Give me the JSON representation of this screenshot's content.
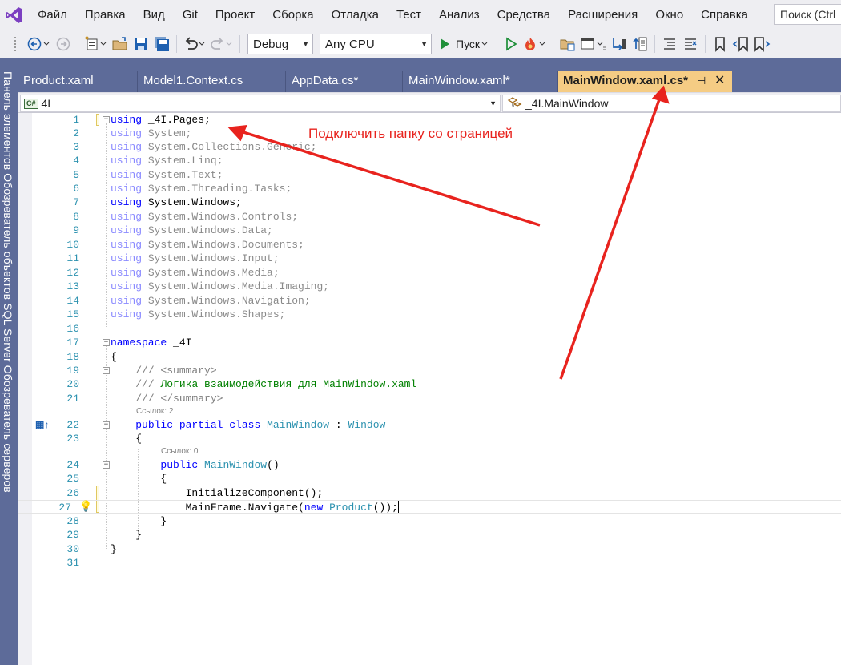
{
  "menu": [
    "Файл",
    "Правка",
    "Вид",
    "Git",
    "Проект",
    "Сборка",
    "Отладка",
    "Тест",
    "Анализ",
    "Средства",
    "Расширения",
    "Окно",
    "Справка"
  ],
  "search": {
    "placeholder": "Поиск (Ctrl"
  },
  "toolbar": {
    "configuration": "Debug",
    "platform": "Any CPU",
    "run_label": "Пуск"
  },
  "side_panel_text": "Панель элементов   Обозреватель объектов SQL Server   Обозреватель серверов",
  "tabs": [
    {
      "label": "Product.xaml"
    },
    {
      "label": "Model1.Context.cs"
    },
    {
      "label": "AppData.cs*"
    },
    {
      "label": "MainWindow.xaml*"
    },
    {
      "label": "MainWindow.xaml.cs*",
      "active": true
    }
  ],
  "navbar": {
    "project_badge": "C#",
    "project": "4I",
    "class": "_4I.MainWindow"
  },
  "annotation": {
    "text": "Подключить папку со страницей",
    "color": "#e8231e"
  },
  "code": {
    "l1": {
      "n": "1",
      "kw": "using",
      "rest": " _4I.Pages;"
    },
    "l2": {
      "n": "2",
      "kw": "using",
      "rest": " System;"
    },
    "l3": {
      "n": "3",
      "kw": "using",
      "rest": " System.Collections.Generic;"
    },
    "l4": {
      "n": "4",
      "kw": "using",
      "rest": " System.Linq;"
    },
    "l5": {
      "n": "5",
      "kw": "using",
      "rest": " System.Text;"
    },
    "l6": {
      "n": "6",
      "kw": "using",
      "rest": " System.Threading.Tasks;"
    },
    "l7": {
      "n": "7",
      "kw": "using",
      "rest": " System.Windows;"
    },
    "l8": {
      "n": "8",
      "kw": "using",
      "rest": " System.Windows.Controls;"
    },
    "l9": {
      "n": "9",
      "kw": "using",
      "rest": " System.Windows.Data;"
    },
    "l10": {
      "n": "10",
      "kw": "using",
      "rest": " System.Windows.Documents;"
    },
    "l11": {
      "n": "11",
      "kw": "using",
      "rest": " System.Windows.Input;"
    },
    "l12": {
      "n": "12",
      "kw": "using",
      "rest": " System.Windows.Media;"
    },
    "l13": {
      "n": "13",
      "kw": "using",
      "rest": " System.Windows.Media.Imaging;"
    },
    "l14": {
      "n": "14",
      "kw": "using",
      "rest": " System.Windows.Navigation;"
    },
    "l15": {
      "n": "15",
      "kw": "using",
      "rest": " System.Windows.Shapes;"
    },
    "l16": {
      "n": "16"
    },
    "l17": {
      "n": "17",
      "kw": "namespace",
      "rest": " _4I"
    },
    "l18": {
      "n": "18",
      "rest": "{"
    },
    "l19": {
      "n": "19",
      "c": "/// <summary>"
    },
    "l20": {
      "n": "20",
      "c1": "/// ",
      "c2": "Логика взаимодействия для MainWindow.xaml"
    },
    "l21": {
      "n": "21",
      "c": "/// </summary>"
    },
    "ref_class": "Ссылок: 2",
    "l22": {
      "n": "22",
      "kw": "public partial class",
      "sp": " ",
      "ty": "MainWindow",
      "mid": " : ",
      "ty2": "Window"
    },
    "l23": {
      "n": "23",
      "rest": "{"
    },
    "ref_ctor": "Ссылок: 0",
    "l24": {
      "n": "24",
      "kw": "public",
      "sp": " ",
      "ty": "MainWindow",
      "rest": "()"
    },
    "l25": {
      "n": "25",
      "rest": "{"
    },
    "l26": {
      "n": "26",
      "rest": "InitializeComponent();"
    },
    "l27": {
      "n": "27",
      "a": "MainFrame.Navigate(",
      "kw": "new",
      "sp": " ",
      "ty": "Product",
      "b": "());"
    },
    "l28": {
      "n": "28",
      "rest": "}"
    },
    "l29": {
      "n": "29",
      "rest": "}"
    },
    "l30": {
      "n": "30",
      "rest": "}"
    },
    "l31": {
      "n": "31"
    }
  }
}
